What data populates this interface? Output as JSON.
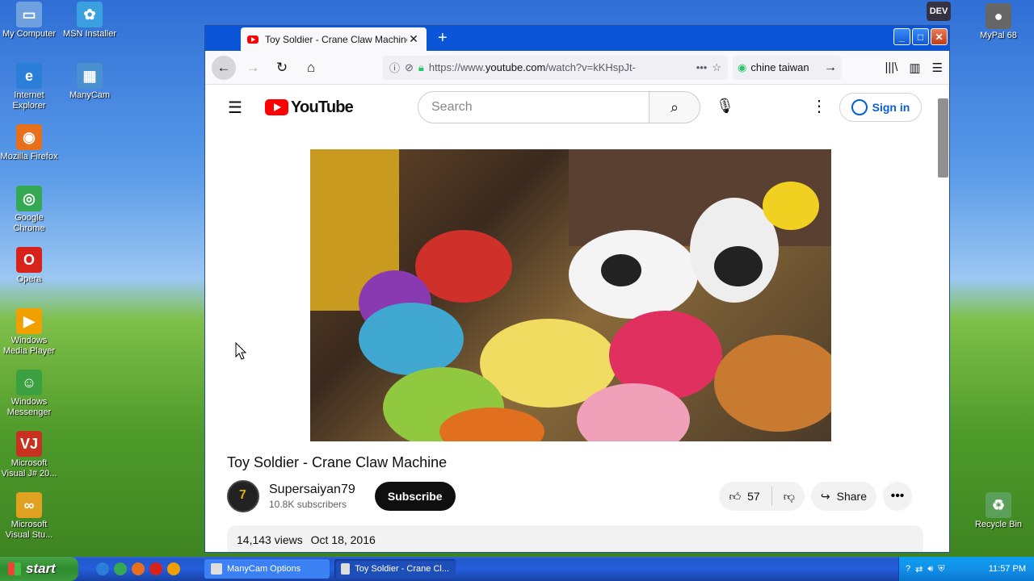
{
  "desktop": {
    "icons_left": [
      {
        "label": "My Computer",
        "color": "#6fa0e0",
        "glyph": "▭"
      },
      {
        "label": "Internet Explorer",
        "color": "#2a7fd8",
        "glyph": "e"
      },
      {
        "label": "Mozilla Firefox",
        "color": "#e8701a",
        "glyph": "◉"
      },
      {
        "label": "Google Chrome",
        "color": "#34a853",
        "glyph": "◎"
      },
      {
        "label": "Opera",
        "color": "#d8221c",
        "glyph": "O"
      },
      {
        "label": "Windows Media Player",
        "color": "#f0a000",
        "glyph": "▶"
      },
      {
        "label": "Windows Messenger",
        "color": "#3aa040",
        "glyph": "☺"
      },
      {
        "label": "Microsoft Visual J# 20...",
        "color": "#c83020",
        "glyph": "VJ"
      },
      {
        "label": "Microsoft Visual Stu...",
        "color": "#e0a020",
        "glyph": "∞"
      }
    ],
    "icons_col2": [
      {
        "label": "MSN Installer",
        "color": "#3aa0e0",
        "glyph": "✿"
      },
      {
        "label": "ManyCam",
        "color": "#4a90d0",
        "glyph": "▦"
      }
    ],
    "dev_icon": {
      "label": "DEV"
    },
    "mypal_icon": {
      "label": "MyPal 68",
      "color": "#555"
    },
    "recycle_bin": {
      "label": "Recycle Bin",
      "color": "#5aa05a"
    }
  },
  "browser": {
    "tab_title": "Toy Soldier - Crane Claw Machine",
    "tab_close": "✕",
    "new_tab": "+",
    "url_prefix": "https://www.",
    "url_domain": "youtube.com",
    "url_suffix": "/watch?v=kKHspJt-",
    "search_text": "chine taiwan",
    "win_minimize": "_",
    "win_maximize": "□",
    "win_close": "✕"
  },
  "youtube": {
    "logo_text": "YouTube",
    "search_placeholder": "Search",
    "sign_in": "Sign in",
    "video_title": "Toy Soldier - Crane Claw Machine",
    "channel_name": "Supersaiyan79",
    "subscribers": "10.8K subscribers",
    "subscribe_label": "Subscribe",
    "likes": "57",
    "share_label": "Share",
    "views": "14,143 views",
    "date": "Oct 18, 2016"
  },
  "taskbar": {
    "start_label": "start",
    "tasks": [
      {
        "label": "ManyCam Options",
        "active": false
      },
      {
        "label": "Toy Soldier - Crane Cl...",
        "active": true
      }
    ],
    "clock": "11:57 PM"
  }
}
